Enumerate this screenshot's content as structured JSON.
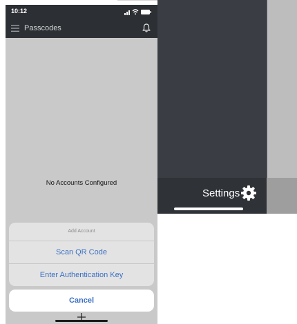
{
  "status_bar": {
    "time": "10:12"
  },
  "navbar": {
    "title": "Passcodes",
    "menu_icon": "hamburger-menu-icon",
    "bell_icon": "bell-icon"
  },
  "content": {
    "empty_message": "No Accounts Configured"
  },
  "action_sheet": {
    "title": "Add Account",
    "options": [
      "Scan QR Code",
      "Enter Authentication Key"
    ],
    "cancel_label": "Cancel"
  },
  "background_screen": {
    "settings_label": "Settings",
    "settings_icon": "gear-icon"
  },
  "colors": {
    "navbar": "#2c2f33",
    "action_text": "#3b70c4",
    "content_bg": "#c9c9c9",
    "dark_panel": "#3a3d43"
  }
}
